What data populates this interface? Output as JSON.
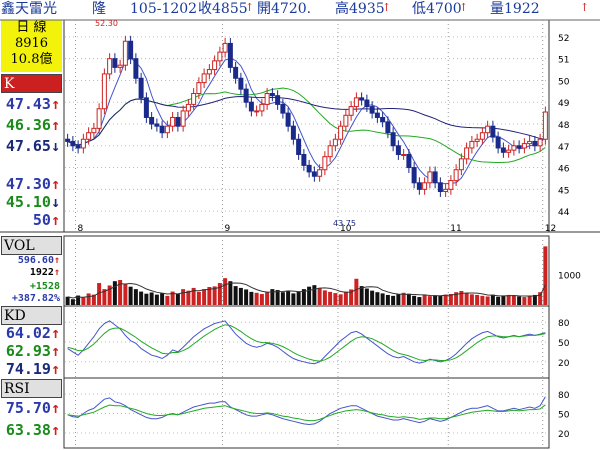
{
  "header": {
    "stock_name": "鑫天雷光",
    "tag": "隆",
    "date": "105-1202",
    "close": "收4855",
    "open": "開4720.",
    "high": "高4935",
    "low": "低4700",
    "volume": "量1922",
    "up_arrow": "↑",
    "down_arrow": "↓"
  },
  "info_box": {
    "period": "日 線",
    "code": "8916",
    "capital": "10.8億"
  },
  "price_panel": {
    "label": "K",
    "ma_values": [
      "47.43",
      "46.36",
      "47.65"
    ],
    "ma_dirs": [
      "↑",
      "↑",
      "↓"
    ],
    "other_values": [
      "47.30",
      "45.10",
      "50"
    ],
    "other_dirs": [
      "↑",
      "↓",
      "↑"
    ],
    "high_marker": "52.30",
    "low_marker": "43.75",
    "y_ticks": [
      "52",
      "51",
      "50",
      "49",
      "48",
      "47",
      "46",
      "45",
      "44"
    ],
    "month_labels": [
      "8",
      "9",
      "10",
      "11",
      "12"
    ]
  },
  "vol_panel": {
    "label": "VOL",
    "values": [
      "596.60",
      "1922",
      "+1528",
      "+387.82%"
    ],
    "dirs": [
      "↑",
      "↑",
      "",
      ""
    ],
    "y_tick": "1000"
  },
  "kd_panel": {
    "label": "KD",
    "values": [
      "64.02",
      "62.93",
      "74.19"
    ],
    "dirs": [
      "↑",
      "↑",
      "↑"
    ],
    "y_ticks": [
      "80",
      "50",
      "20"
    ]
  },
  "rsi_panel": {
    "label": "RSI",
    "values": [
      "75.70",
      "63.38"
    ],
    "dirs": [
      "↑",
      "↑"
    ],
    "y_ticks": [
      "80",
      "50",
      "20"
    ]
  },
  "colors": {
    "up": "#cc2222",
    "down": "#1a2a8a",
    "ma5": "#4455cc",
    "ma20": "#22aa22",
    "ma60": "#22227a",
    "grid": "#bbbbbb",
    "header_text": "#1a3a9a",
    "panel_label_bg": "#d8d8d8",
    "red_label_bg": "#cc2020"
  },
  "chart_data": [
    {
      "type": "candlestick",
      "title": "K",
      "x_months": [
        "8",
        "9",
        "10",
        "11",
        "12"
      ],
      "ylim": [
        43.5,
        52.5
      ],
      "open": [
        47.3,
        47.2,
        47.0,
        46.9,
        47.3,
        47.6,
        47.8,
        48.7,
        50.3,
        51.0,
        50.6,
        50.7,
        51.8,
        51.0,
        50.1,
        49.2,
        48.3,
        48.0,
        47.9,
        47.6,
        47.9,
        48.3,
        47.9,
        48.6,
        48.9,
        49.4,
        49.9,
        50.3,
        50.5,
        50.9,
        51.3,
        51.7,
        50.6,
        50.1,
        49.6,
        49.0,
        48.6,
        48.6,
        48.9,
        49.4,
        49.3,
        48.9,
        48.5,
        47.9,
        47.3,
        46.6,
        46.1,
        45.8,
        45.6,
        45.9,
        46.5,
        47.0,
        47.3,
        47.9,
        48.4,
        48.8,
        49.2,
        49.1,
        48.8,
        48.5,
        48.3,
        48.1,
        47.6,
        47.0,
        46.6,
        46.6,
        46.0,
        45.3,
        45.0,
        45.3,
        45.8,
        45.3,
        44.9,
        45.0,
        45.4,
        45.9,
        46.4,
        46.9,
        47.2,
        47.3,
        47.6,
        47.9,
        47.4,
        46.9,
        46.7,
        46.8,
        47.0,
        46.9,
        47.1,
        47.2,
        47.0,
        47.3
      ],
      "close": [
        47.2,
        47.0,
        46.9,
        47.3,
        47.6,
        47.8,
        48.7,
        50.3,
        51.0,
        50.6,
        50.7,
        51.8,
        51.0,
        50.1,
        49.2,
        48.3,
        48.0,
        47.9,
        47.6,
        47.9,
        48.3,
        47.9,
        48.6,
        48.9,
        49.4,
        49.9,
        50.3,
        50.5,
        50.9,
        51.3,
        51.7,
        50.6,
        50.1,
        49.6,
        49.0,
        48.6,
        48.6,
        48.9,
        49.4,
        49.3,
        48.9,
        48.5,
        47.9,
        47.3,
        46.6,
        46.1,
        45.8,
        45.6,
        45.9,
        46.5,
        47.0,
        47.3,
        47.9,
        48.4,
        48.8,
        49.2,
        49.1,
        48.8,
        48.5,
        48.3,
        48.1,
        47.6,
        47.0,
        46.6,
        46.6,
        46.0,
        45.3,
        45.0,
        45.3,
        45.8,
        45.3,
        44.9,
        45.0,
        45.4,
        45.9,
        46.4,
        46.9,
        47.2,
        47.3,
        47.6,
        47.9,
        47.4,
        46.9,
        46.7,
        46.8,
        47.0,
        46.9,
        47.1,
        47.2,
        47.0,
        47.3,
        48.55
      ],
      "high_label": 52.3,
      "low_label": 43.75
    },
    {
      "type": "bar",
      "title": "VOL",
      "ylim": [
        0,
        2000
      ],
      "values": [
        270,
        190,
        310,
        250,
        380,
        340,
        720,
        520,
        640,
        780,
        820,
        690,
        600,
        520,
        440,
        370,
        410,
        340,
        380,
        300,
        440,
        360,
        520,
        470,
        560,
        430,
        520,
        590,
        610,
        720,
        880,
        780,
        620,
        560,
        510,
        430,
        400,
        360,
        420,
        520,
        490,
        420,
        460,
        380,
        440,
        520,
        600,
        650,
        560,
        480,
        430,
        390,
        350,
        440,
        510,
        860,
        620,
        540,
        470,
        420,
        380,
        330,
        300,
        350,
        400,
        370,
        300,
        260,
        340,
        290,
        320,
        300,
        340,
        360,
        420,
        460,
        380,
        350,
        330,
        300,
        280,
        340,
        270,
        300,
        330,
        310,
        280,
        260,
        300,
        330,
        420,
        1922
      ]
    },
    {
      "type": "line",
      "title": "KD",
      "ylim": [
        0,
        100
      ],
      "series": [
        {
          "name": "K",
          "values": [
            40,
            35,
            30,
            38,
            48,
            58,
            70,
            78,
            82,
            76,
            70,
            60,
            52,
            48,
            40,
            35,
            30,
            28,
            25,
            30,
            38,
            35,
            42,
            50,
            58,
            64,
            70,
            74,
            78,
            80,
            82,
            72,
            62,
            55,
            48,
            44,
            42,
            44,
            48,
            46,
            42,
            36,
            30,
            25,
            22,
            20,
            18,
            17,
            20,
            28,
            36,
            44,
            52,
            58,
            64,
            66,
            62,
            56,
            50,
            44,
            38,
            32,
            28,
            26,
            28,
            24,
            20,
            18,
            20,
            24,
            22,
            20,
            22,
            26,
            32,
            40,
            48,
            55,
            60,
            64,
            66,
            62,
            58,
            56,
            58,
            60,
            58,
            60,
            62,
            60,
            62,
            64.02
          ]
        },
        {
          "name": "D",
          "values": [
            42,
            40,
            37,
            37,
            41,
            47,
            55,
            63,
            69,
            71,
            71,
            67,
            62,
            57,
            51,
            46,
            41,
            37,
            33,
            32,
            34,
            34,
            37,
            41,
            47,
            53,
            59,
            64,
            69,
            73,
            76,
            75,
            71,
            66,
            60,
            55,
            51,
            49,
            49,
            48,
            46,
            43,
            39,
            34,
            30,
            27,
            24,
            22,
            21,
            23,
            27,
            33,
            39,
            45,
            51,
            56,
            58,
            57,
            55,
            51,
            47,
            42,
            37,
            33,
            31,
            29,
            26,
            23,
            22,
            23,
            23,
            22,
            22,
            23,
            26,
            31,
            37,
            43,
            49,
            54,
            58,
            59,
            59,
            58,
            58,
            59,
            58,
            59,
            60,
            60,
            61,
            62.93
          ]
        }
      ]
    },
    {
      "type": "line",
      "title": "RSI",
      "ylim": [
        0,
        100
      ],
      "series": [
        {
          "name": "RSI1",
          "values": [
            48,
            45,
            44,
            50,
            55,
            58,
            65,
            72,
            74,
            68,
            66,
            62,
            56,
            52,
            48,
            44,
            42,
            42,
            44,
            48,
            50,
            48,
            52,
            56,
            60,
            62,
            64,
            66,
            66,
            68,
            68,
            60,
            56,
            52,
            48,
            46,
            46,
            48,
            50,
            48,
            45,
            42,
            40,
            38,
            36,
            34,
            33,
            34,
            38,
            44,
            50,
            54,
            58,
            60,
            62,
            62,
            58,
            54,
            50,
            46,
            44,
            42,
            40,
            40,
            42,
            40,
            38,
            36,
            38,
            42,
            40,
            38,
            40,
            44,
            48,
            52,
            56,
            58,
            58,
            60,
            62,
            58,
            54,
            54,
            56,
            58,
            56,
            58,
            60,
            58,
            62,
            75.7
          ]
        },
        {
          "name": "RSI2",
          "values": [
            48,
            47,
            46,
            48,
            50,
            52,
            56,
            60,
            63,
            62,
            62,
            60,
            58,
            56,
            53,
            50,
            48,
            47,
            47,
            48,
            49,
            48,
            50,
            52,
            54,
            56,
            58,
            59,
            60,
            61,
            62,
            59,
            57,
            55,
            53,
            51,
            50,
            50,
            51,
            50,
            48,
            46,
            45,
            43,
            42,
            40,
            39,
            39,
            41,
            44,
            47,
            50,
            52,
            54,
            55,
            56,
            55,
            53,
            51,
            49,
            48,
            46,
            45,
            44,
            45,
            44,
            43,
            41,
            42,
            43,
            43,
            42,
            42,
            44,
            46,
            48,
            50,
            52,
            53,
            54,
            55,
            54,
            53,
            53,
            54,
            55,
            54,
            55,
            56,
            56,
            57,
            63.38
          ]
        }
      ]
    }
  ]
}
